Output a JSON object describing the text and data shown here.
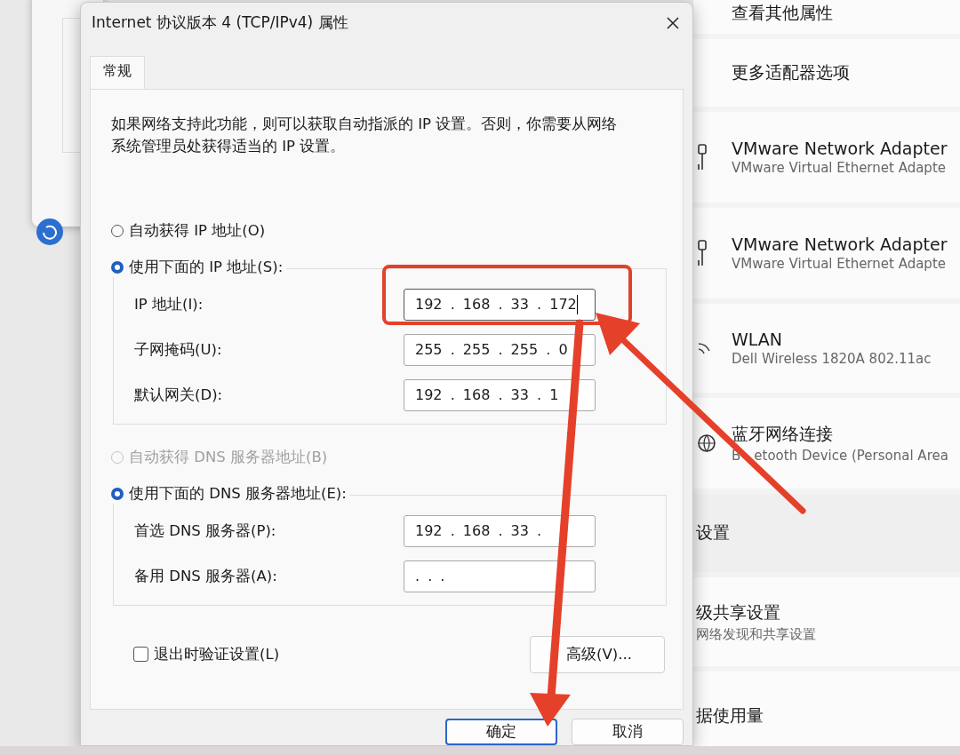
{
  "background_window": {
    "rows": [
      {
        "kind": "link",
        "title": "查看其他属性"
      },
      {
        "kind": "link",
        "title": "更多适配器选项"
      },
      {
        "kind": "ethernet",
        "title": "VMware Network Adapter",
        "subtitle": "VMware Virtual Ethernet Adapte"
      },
      {
        "kind": "ethernet",
        "title": "VMware Network Adapter",
        "subtitle": "VMware Virtual Ethernet Adapte"
      },
      {
        "kind": "wifi",
        "title": "WLAN",
        "subtitle": "Dell Wireless 1820A 802.11ac"
      },
      {
        "kind": "globe",
        "title": "蓝牙网络连接",
        "subtitle_parts": [
          "B",
          "etooth Device (Personal Area"
        ]
      },
      {
        "kind": "section",
        "title": "设置"
      },
      {
        "kind": "partial",
        "title": "级共享设置",
        "subtitle": "网络发现和共享设置"
      },
      {
        "kind": "partial",
        "title": "据使用量"
      }
    ]
  },
  "dialog": {
    "title": "Internet 协议版本 4 (TCP/IPv4) 属性",
    "tabs": [
      {
        "label": "常规",
        "selected": true
      }
    ],
    "description": "如果网络支持此功能，则可以获取自动指派的 IP 设置。否则，你需要从网络系统管理员处获得适当的 IP 设置。",
    "ip_mode": [
      {
        "label": "自动获得 IP 地址(O)",
        "selected": false,
        "disabled": false
      },
      {
        "label": "使用下面的 IP 地址(S):",
        "selected": true,
        "disabled": false
      }
    ],
    "ip_fields": [
      {
        "label": "IP 地址(I):",
        "value": "192 . 168 . 33 . 172",
        "focused": true
      },
      {
        "label": "子网掩码(U):",
        "value": "255 . 255 . 255 . 0",
        "focused": false
      },
      {
        "label": "默认网关(D):",
        "value": "192 . 168 . 33 . 1",
        "focused": false
      }
    ],
    "dns_mode": [
      {
        "label": "自动获得 DNS 服务器地址(B)",
        "selected": false,
        "disabled": true
      },
      {
        "label": "使用下面的 DNS 服务器地址(E):",
        "selected": true,
        "disabled": false
      }
    ],
    "dns_fields": [
      {
        "label": "首选 DNS 服务器(P):",
        "value": "192 . 168 . 33 .",
        "focused": false
      },
      {
        "label": "备用 DNS 服务器(A):",
        "value": ". . .",
        "focused": false
      }
    ],
    "validate_on_exit": {
      "label": "退出时验证设置(L)",
      "checked": false
    },
    "advanced_button": "高级(V)...",
    "buttons": [
      {
        "label": "确定",
        "default": true
      },
      {
        "label": "取消",
        "default": false
      }
    ]
  }
}
